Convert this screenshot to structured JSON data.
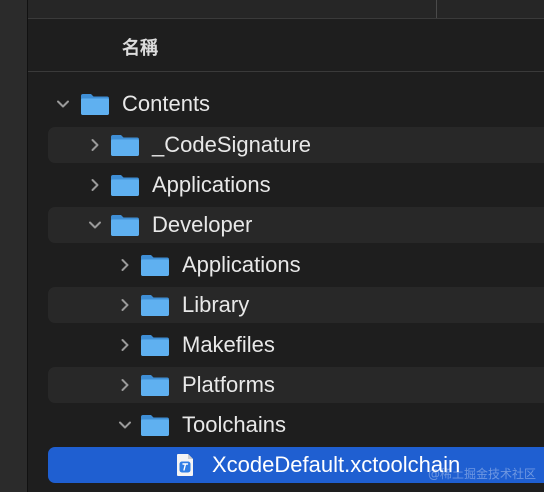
{
  "header": {
    "name_column": "名稱"
  },
  "tree": [
    {
      "label": "Contents",
      "expanded": true,
      "depth": 0,
      "kind": "folder"
    },
    {
      "label": "_CodeSignature",
      "expanded": false,
      "depth": 1,
      "kind": "folder"
    },
    {
      "label": "Applications",
      "expanded": false,
      "depth": 1,
      "kind": "folder"
    },
    {
      "label": "Developer",
      "expanded": true,
      "depth": 1,
      "kind": "folder"
    },
    {
      "label": "Applications",
      "expanded": false,
      "depth": 2,
      "kind": "folder"
    },
    {
      "label": "Library",
      "expanded": false,
      "depth": 2,
      "kind": "folder"
    },
    {
      "label": "Makefiles",
      "expanded": false,
      "depth": 2,
      "kind": "folder"
    },
    {
      "label": "Platforms",
      "expanded": false,
      "depth": 2,
      "kind": "folder"
    },
    {
      "label": "Toolchains",
      "expanded": true,
      "depth": 2,
      "kind": "folder"
    },
    {
      "label": "XcodeDefault.xctoolchain",
      "selected": true,
      "depth": 3,
      "kind": "xctoolchain"
    }
  ],
  "watermark": "@稀土掘金技术社区",
  "colors": {
    "background": "#1e1e1e",
    "alt_row": "#282828",
    "selection": "#1f5fd1",
    "folder": "#5fb0f0"
  }
}
